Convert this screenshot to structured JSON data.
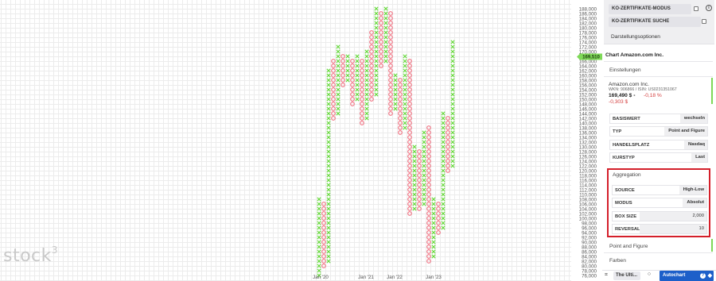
{
  "chart": {
    "y_axis_ticks": [
      "188,000",
      "186,000",
      "184,000",
      "182,000",
      "180,000",
      "178,000",
      "176,000",
      "174,000",
      "172,000",
      "170,000",
      "168,000",
      "166,000",
      "164,000",
      "162,000",
      "160,000",
      "158,000",
      "156,000",
      "154,000",
      "152,000",
      "150,000",
      "148,000",
      "146,000",
      "144,000",
      "142,000",
      "140,000",
      "138,000",
      "136,000",
      "134,000",
      "132,000",
      "130,000",
      "128,000",
      "126,000",
      "124,000",
      "122,000",
      "120,000",
      "118,000",
      "116,000",
      "114,000",
      "112,000",
      "110,000",
      "108,000",
      "106,000",
      "104,000",
      "102,000",
      "100,000",
      "98,000",
      "96,000",
      "94,000",
      "92,000",
      "90,000",
      "88,000",
      "86,000",
      "84,000",
      "82,000",
      "80,000",
      "78,000",
      "76,000"
    ],
    "price_tag": "169,510",
    "x_axis_labels": [
      "Jan '20",
      "Jan '21",
      "Jan '22",
      "Jan '23"
    ],
    "watermark": "stock",
    "watermark_sup": "3",
    "colors": {
      "x_color": "#66d93c",
      "o_color": "#f07080",
      "grid": "#ececec",
      "tag": "#7ed957"
    }
  },
  "chart_data": {
    "type": "point-and-figure",
    "title": "Chart Amazon.com Inc.",
    "box_size": 2000,
    "reversal": 10,
    "ylim": [
      76000,
      188000
    ],
    "x_labels": [
      "Jan '20",
      "Jan '21",
      "Jan '22",
      "Jan '23"
    ],
    "columns": [
      {
        "type": "X",
        "low": 76000,
        "high": 108000
      },
      {
        "type": "O",
        "low": 80000,
        "high": 106000
      },
      {
        "type": "X",
        "low": 82000,
        "high": 162000
      },
      {
        "type": "O",
        "low": 142000,
        "high": 166000
      },
      {
        "type": "X",
        "low": 144000,
        "high": 172000
      },
      {
        "type": "O",
        "low": 156000,
        "high": 168000
      },
      {
        "type": "X",
        "low": 158000,
        "high": 168000
      },
      {
        "type": "O",
        "low": 148000,
        "high": 166000
      },
      {
        "type": "X",
        "low": 150000,
        "high": 168000
      },
      {
        "type": "O",
        "low": 140000,
        "high": 166000
      },
      {
        "type": "X",
        "low": 142000,
        "high": 170000
      },
      {
        "type": "O",
        "low": 150000,
        "high": 178000
      },
      {
        "type": "X",
        "low": 152000,
        "high": 188000
      },
      {
        "type": "O",
        "low": 164000,
        "high": 186000
      },
      {
        "type": "X",
        "low": 166000,
        "high": 188000
      },
      {
        "type": "O",
        "low": 144000,
        "high": 186000
      },
      {
        "type": "X",
        "low": 146000,
        "high": 160000
      },
      {
        "type": "O",
        "low": 136000,
        "high": 158000
      },
      {
        "type": "X",
        "low": 138000,
        "high": 168000
      },
      {
        "type": "O",
        "low": 102000,
        "high": 166000
      },
      {
        "type": "X",
        "low": 104000,
        "high": 130000
      },
      {
        "type": "O",
        "low": 104000,
        "high": 128000
      },
      {
        "type": "X",
        "low": 106000,
        "high": 136000
      },
      {
        "type": "O",
        "low": 82000,
        "high": 138000
      },
      {
        "type": "X",
        "low": 84000,
        "high": 108000
      },
      {
        "type": "O",
        "low": 94000,
        "high": 106000
      },
      {
        "type": "X",
        "low": 96000,
        "high": 144000
      },
      {
        "type": "O",
        "low": 120000,
        "high": 142000
      },
      {
        "type": "X",
        "low": 122000,
        "high": 174000
      }
    ]
  },
  "menu": {
    "modus_label": "KO-ZERTIFIKATE-MODUS",
    "suche_label": "KO-ZERTIFIKATE SUCHE",
    "info_glyph": "i",
    "display_options": "Darstellungsoptionen"
  },
  "sidebar": {
    "chart_title": "Chart Amazon.com Inc.",
    "einstellungen": "Einstellungen",
    "stock_name": "Amazon.com Inc.",
    "stock_ids": "WKN: 906866 / ISIN: US0231351067",
    "stock_price": "169,490 $",
    "stock_sep": "•",
    "stock_pct": "-0,18 %",
    "stock_abs": "-0,303 $",
    "settings": [
      {
        "key": "BASISWERT",
        "value": "wechseln"
      },
      {
        "key": "TYP",
        "value": "Point and Figure"
      },
      {
        "key": "HANDELSPLATZ",
        "value": "Nasdaq"
      },
      {
        "key": "KURSTYP",
        "value": "Last"
      }
    ],
    "aggregation": {
      "title": "Aggregation",
      "rows": [
        {
          "key": "SOURCE",
          "value": "High-Low"
        },
        {
          "key": "MODUS",
          "value": "Absolut"
        },
        {
          "key": "BOX SIZE",
          "value": "2,000"
        },
        {
          "key": "REVERSAL",
          "value": "10"
        }
      ]
    },
    "point_and_figure": "Point and Figure",
    "farben": "Farben"
  },
  "bottom_bar": {
    "grid_icon": "⌗",
    "tab_label": "The Ulti...",
    "select_glyph": "○",
    "autochart_label": "Autochart",
    "help_glyph": "?",
    "tag_glyph": "◆"
  }
}
